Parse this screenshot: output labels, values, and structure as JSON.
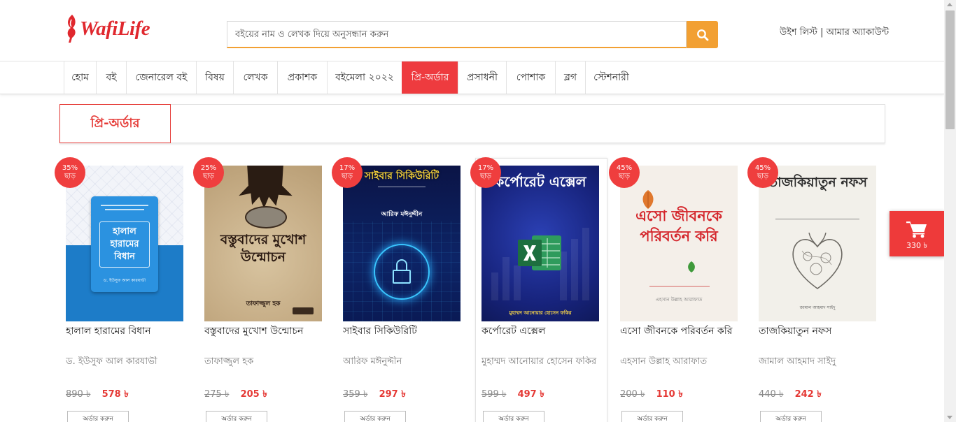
{
  "header": {
    "logo": "WafiLife",
    "search": {
      "placeholder": "বইয়ের নাম ও লেখক দিয়ে অনুসন্ধান করুন",
      "value": ""
    },
    "links": {
      "wishlist": "উইশ লিস্ট",
      "separator": "|",
      "account": "আমার অ্যাকাউন্ট"
    }
  },
  "nav": {
    "items": [
      {
        "label": "হোম",
        "active": false
      },
      {
        "label": "বই",
        "active": false
      },
      {
        "label": "জেনারেল বই",
        "active": false
      },
      {
        "label": "বিষয়",
        "active": false
      },
      {
        "label": "লেখক",
        "active": false
      },
      {
        "label": "প্রকাশক",
        "active": false
      },
      {
        "label": "বইমেলা ২০২২",
        "active": false
      },
      {
        "label": "প্রি-অর্ডার",
        "active": true
      },
      {
        "label": "প্রসাধনী",
        "active": false
      },
      {
        "label": "পোশাক",
        "active": false
      },
      {
        "label": "ব্লগ",
        "active": false
      },
      {
        "label": "স্টেশনারী",
        "active": false
      }
    ]
  },
  "section": {
    "title": "প্রি-অর্ডার"
  },
  "products": [
    {
      "title": "হালাল হারামের বিধান",
      "author": "ড. ইউসুফ আল কারযাভী",
      "old_price": "890 ৳",
      "price": "578 ৳",
      "discount": "35%",
      "discount_label": "ছাড়",
      "button": "অর্ডার করুন"
    },
    {
      "title": "বস্তুবাদের মুখোশ উন্মোচন",
      "author": "তাফাজ্জুল হক",
      "old_price": "275 ৳",
      "price": "205 ৳",
      "discount": "25%",
      "discount_label": "ছাড়",
      "button": "অর্ডার করুন"
    },
    {
      "title": "সাইবার সিকিউরিটি",
      "author": "আরিফ মঈনুদ্দীন",
      "old_price": "359 ৳",
      "price": "297 ৳",
      "discount": "17%",
      "discount_label": "ছাড়",
      "button": "অর্ডার করুন"
    },
    {
      "title": "কর্পোরেট এক্সেল",
      "author": "মুহাম্মদ আনোয়ার হোসেন ফকির",
      "old_price": "599 ৳",
      "price": "497 ৳",
      "discount": "17%",
      "discount_label": "ছাড়",
      "button": "অর্ডার করুন"
    },
    {
      "title": "এসো জীবনকে পরিবর্তন করি",
      "author": "এহসান উল্লাহ আরাফাত",
      "old_price": "200 ৳",
      "price": "110 ৳",
      "discount": "45%",
      "discount_label": "ছাড়",
      "button": "অর্ডার করুন"
    },
    {
      "title": "তাজকিয়াতুন নফস",
      "author": "জামাল আহমাদ সাইদু",
      "old_price": "440 ৳",
      "price": "242 ৳",
      "discount": "45%",
      "discount_label": "ছাড়",
      "button": "অর্ডার করুন"
    }
  ],
  "cart": {
    "total": "330 ৳"
  },
  "icons": {
    "logo": "wafilife-logo-icon",
    "search": "search-icon",
    "cart": "cart-icon"
  },
  "colors": {
    "brand_red": "#ee3b3f",
    "search_orange": "#f2a033",
    "text": "#333333",
    "muted": "#7b7b7b"
  }
}
